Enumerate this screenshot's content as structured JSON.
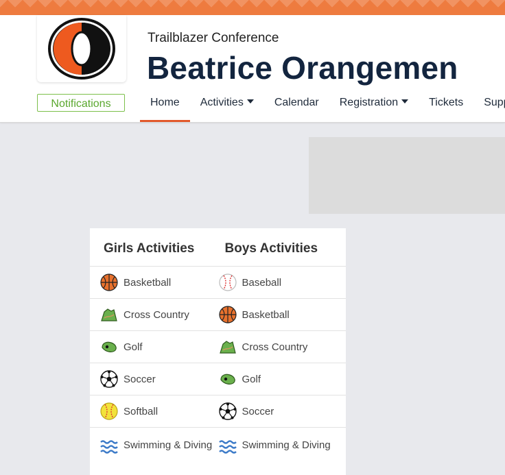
{
  "header": {
    "conference": "Trailblazer Conference",
    "school_name": "Beatrice Orangemen",
    "logo_letter": "O",
    "notifications_label": "Notifications",
    "colors": {
      "accent": "#e2592b",
      "navy": "#13253f",
      "green": "#5aa72e",
      "band": "#ee7b3f"
    }
  },
  "nav": {
    "items": [
      {
        "label": "Home",
        "active": true
      },
      {
        "label": "Activities",
        "dropdown": true
      },
      {
        "label": "Calendar"
      },
      {
        "label": "Registration",
        "dropdown": true
      },
      {
        "label": "Tickets"
      },
      {
        "label": "Supp"
      }
    ]
  },
  "activities": {
    "girls_title": "Girls Activities",
    "boys_title": "Boys Activities",
    "girls": [
      {
        "label": "Basketball",
        "icon": "basketball-icon"
      },
      {
        "label": "Cross Country",
        "icon": "cross-country-icon"
      },
      {
        "label": "Golf",
        "icon": "golf-icon"
      },
      {
        "label": "Soccer",
        "icon": "soccer-icon"
      },
      {
        "label": "Softball",
        "icon": "softball-icon"
      },
      {
        "label": "Swimming & Diving",
        "icon": "swimming-icon"
      }
    ],
    "boys": [
      {
        "label": "Baseball",
        "icon": "baseball-icon"
      },
      {
        "label": "Basketball",
        "icon": "basketball-icon"
      },
      {
        "label": "Cross Country",
        "icon": "cross-country-icon"
      },
      {
        "label": "Golf",
        "icon": "golf-icon"
      },
      {
        "label": "Soccer",
        "icon": "soccer-icon"
      },
      {
        "label": "Swimming & Diving",
        "icon": "swimming-icon"
      }
    ]
  }
}
